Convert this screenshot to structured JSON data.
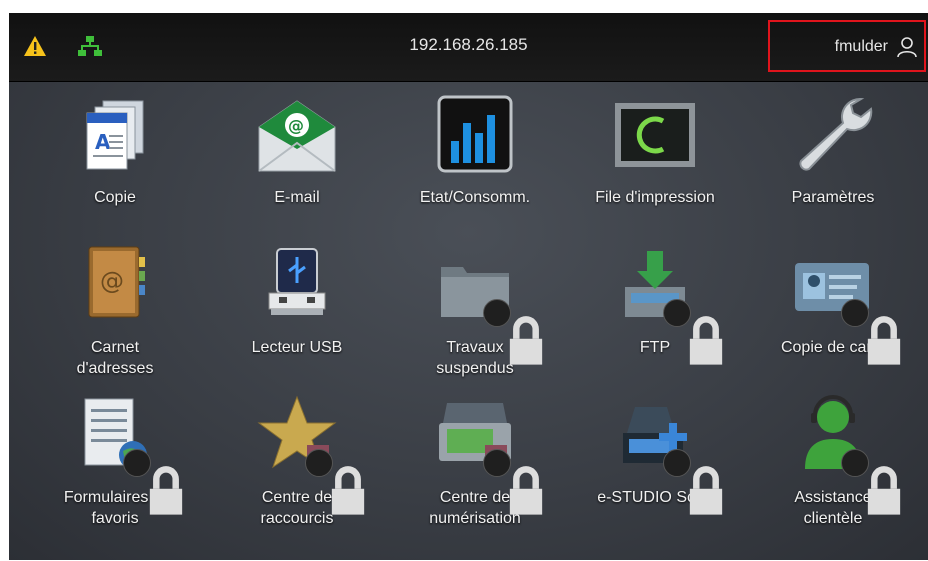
{
  "topbar": {
    "ip_address": "192.168.26.185",
    "username": "fmulder",
    "warning_icon": "warning-triangle-icon",
    "network_icon": "network-icon",
    "user_icon": "user-icon"
  },
  "colors": {
    "warning": "#f6c21b",
    "network": "#3fbf3a",
    "highlight_border": "#e0141c"
  },
  "tiles": [
    {
      "label": "Copie",
      "icon": "copy-icon",
      "locked": false
    },
    {
      "label": "E-mail",
      "icon": "email-icon",
      "locked": false
    },
    {
      "label": "Etat/Consomm.",
      "icon": "status-supplies-icon",
      "locked": false
    },
    {
      "label": "File d'impression",
      "icon": "print-queue-icon",
      "locked": false
    },
    {
      "label": "Paramètres",
      "icon": "wrench-icon",
      "locked": false
    },
    {
      "label": "Carnet\nd'adresses",
      "icon": "address-book-icon",
      "locked": false
    },
    {
      "label": "Lecteur USB",
      "icon": "usb-drive-icon",
      "locked": false
    },
    {
      "label": "Travaux\nsuspendus",
      "icon": "held-jobs-folder-icon",
      "locked": true
    },
    {
      "label": "FTP",
      "icon": "ftp-icon",
      "locked": true
    },
    {
      "label": "Copie de carte",
      "icon": "card-copy-icon",
      "locked": true
    },
    {
      "label": "Formulaires et\nfavoris",
      "icon": "forms-favorites-icon",
      "locked": true
    },
    {
      "label": "Centre de\nraccourcis",
      "icon": "shortcut-star-icon",
      "locked": true
    },
    {
      "label": "Centre de\nnumérisation",
      "icon": "scan-center-icon",
      "locked": true
    },
    {
      "label": "e-STUDIO Scan",
      "icon": "estudio-scan-icon",
      "locked": true
    },
    {
      "label": "Assistance\nclientèle",
      "icon": "customer-support-icon",
      "locked": true
    }
  ]
}
